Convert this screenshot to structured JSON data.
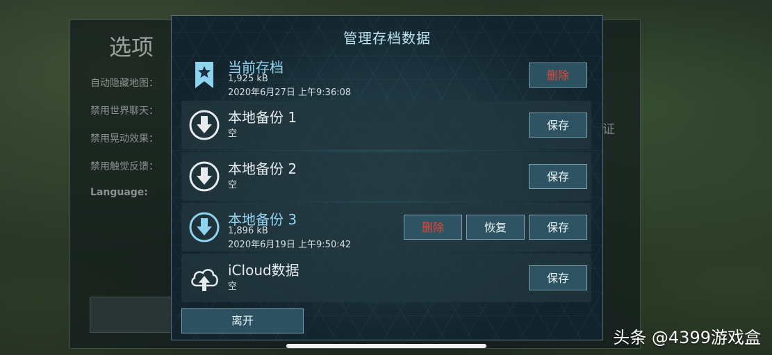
{
  "background_options": {
    "title": "选项",
    "items": [
      {
        "label": "自动隐藏地图："
      },
      {
        "label": "禁用世界聊天："
      },
      {
        "label": "禁用晃动效果："
      },
      {
        "label": "禁用触觉反馈："
      },
      {
        "label": "Language:"
      }
    ],
    "right_fragment": "行证"
  },
  "dialog": {
    "title": "管理存档数据",
    "rows": [
      {
        "name": "当前存档",
        "size": "1,925 kB",
        "date": "2020年6月27日 上午9:36:08",
        "icon": "bookmark-star-icon",
        "buttons": [
          {
            "label": "删除",
            "type": "delete"
          }
        ]
      },
      {
        "name": "本地备份 1",
        "status": "空",
        "icon": "download-circle-icon",
        "buttons": [
          {
            "label": "保存",
            "type": "save"
          }
        ]
      },
      {
        "name": "本地备份 2",
        "status": "空",
        "icon": "download-circle-icon",
        "buttons": [
          {
            "label": "保存",
            "type": "save"
          }
        ]
      },
      {
        "name": "本地备份 3",
        "size": "1,896 kB",
        "date": "2020年6月19日 上午9:50:42",
        "icon": "download-circle-icon",
        "buttons": [
          {
            "label": "删除",
            "type": "delete"
          },
          {
            "label": "恢复",
            "type": "restore"
          },
          {
            "label": "保存",
            "type": "save"
          }
        ]
      },
      {
        "name": "iCloud数据",
        "status": "空",
        "icon": "cloud-upload-icon",
        "buttons": [
          {
            "label": "保存",
            "type": "save"
          }
        ]
      }
    ],
    "leave_label": "离开"
  },
  "watermark": "头条 @4399游戏盒",
  "colors": {
    "accent_text": "#8fd4ef",
    "delete_text": "#e04a3a",
    "button_bg": "#305868"
  }
}
